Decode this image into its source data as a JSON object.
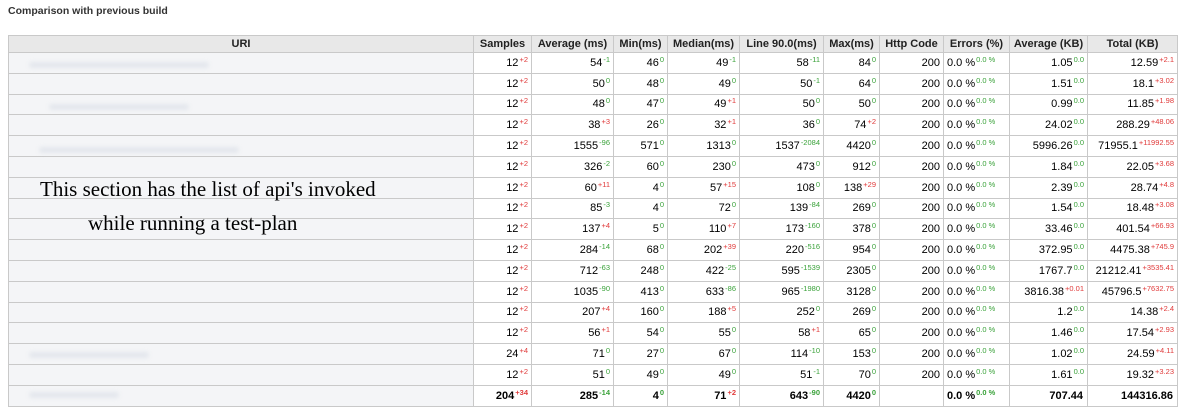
{
  "section_title": "Comparison with previous build",
  "annotation": {
    "line1": "This section has the list of api's invoked",
    "line2": "while running a test-plan"
  },
  "columns": [
    "URI",
    "Samples",
    "Average (ms)",
    "Min(ms)",
    "Median(ms)",
    "Line 90.0(ms)",
    "Max(ms)",
    "Http Code",
    "Errors (%)",
    "Average (KB)",
    "Total (KB)"
  ],
  "rows": [
    {
      "samples": [
        "12",
        "+2"
      ],
      "avg": [
        "54",
        "-1"
      ],
      "min": [
        "46",
        "0"
      ],
      "median": [
        "49",
        "-1"
      ],
      "line90": [
        "58",
        "-11"
      ],
      "max": [
        "84",
        "0"
      ],
      "code": "200",
      "err": [
        "0.0 %",
        "0.0 %"
      ],
      "avgkb": [
        "1.05",
        "0.0"
      ],
      "total": [
        "12.59",
        "+2.1"
      ]
    },
    {
      "samples": [
        "12",
        "+2"
      ],
      "avg": [
        "50",
        "0"
      ],
      "min": [
        "48",
        "0"
      ],
      "median": [
        "49",
        "0"
      ],
      "line90": [
        "50",
        "-1"
      ],
      "max": [
        "64",
        "0"
      ],
      "code": "200",
      "err": [
        "0.0 %",
        "0.0 %"
      ],
      "avgkb": [
        "1.51",
        "0.0"
      ],
      "total": [
        "18.1",
        "+3.02"
      ]
    },
    {
      "samples": [
        "12",
        "+2"
      ],
      "avg": [
        "48",
        "0"
      ],
      "min": [
        "47",
        "0"
      ],
      "median": [
        "49",
        "+1"
      ],
      "line90": [
        "50",
        "0"
      ],
      "max": [
        "50",
        "0"
      ],
      "code": "200",
      "err": [
        "0.0 %",
        "0.0 %"
      ],
      "avgkb": [
        "0.99",
        "0.0"
      ],
      "total": [
        "11.85",
        "+1.98"
      ]
    },
    {
      "samples": [
        "12",
        "+2"
      ],
      "avg": [
        "38",
        "+3"
      ],
      "min": [
        "26",
        "0"
      ],
      "median": [
        "32",
        "+1"
      ],
      "line90": [
        "36",
        "0"
      ],
      "max": [
        "74",
        "+2"
      ],
      "code": "200",
      "err": [
        "0.0 %",
        "0.0 %"
      ],
      "avgkb": [
        "24.02",
        "0.0"
      ],
      "total": [
        "288.29",
        "+48.06"
      ]
    },
    {
      "samples": [
        "12",
        "+2"
      ],
      "avg": [
        "1555",
        "-96"
      ],
      "min": [
        "571",
        "0"
      ],
      "median": [
        "1313",
        "0"
      ],
      "line90": [
        "1537",
        "-2084"
      ],
      "max": [
        "4420",
        "0"
      ],
      "code": "200",
      "err": [
        "0.0 %",
        "0.0 %"
      ],
      "avgkb": [
        "5996.26",
        "0.0"
      ],
      "total": [
        "71955.1",
        "+11992.55"
      ]
    },
    {
      "samples": [
        "12",
        "+2"
      ],
      "avg": [
        "326",
        "-2"
      ],
      "min": [
        "60",
        "0"
      ],
      "median": [
        "230",
        "0"
      ],
      "line90": [
        "473",
        "0"
      ],
      "max": [
        "912",
        "0"
      ],
      "code": "200",
      "err": [
        "0.0 %",
        "0.0 %"
      ],
      "avgkb": [
        "1.84",
        "0.0"
      ],
      "total": [
        "22.05",
        "+3.68"
      ]
    },
    {
      "samples": [
        "12",
        "+2"
      ],
      "avg": [
        "60",
        "+11"
      ],
      "min": [
        "4",
        "0"
      ],
      "median": [
        "57",
        "+15"
      ],
      "line90": [
        "108",
        "0"
      ],
      "max": [
        "138",
        "+29"
      ],
      "code": "200",
      "err": [
        "0.0 %",
        "0.0 %"
      ],
      "avgkb": [
        "2.39",
        "0.0"
      ],
      "total": [
        "28.74",
        "+4.8"
      ]
    },
    {
      "samples": [
        "12",
        "+2"
      ],
      "avg": [
        "85",
        "-3"
      ],
      "min": [
        "4",
        "0"
      ],
      "median": [
        "72",
        "0"
      ],
      "line90": [
        "139",
        "-84"
      ],
      "max": [
        "269",
        "0"
      ],
      "code": "200",
      "err": [
        "0.0 %",
        "0.0 %"
      ],
      "avgkb": [
        "1.54",
        "0.0"
      ],
      "total": [
        "18.48",
        "+3.08"
      ]
    },
    {
      "samples": [
        "12",
        "+2"
      ],
      "avg": [
        "137",
        "+4"
      ],
      "min": [
        "5",
        "0"
      ],
      "median": [
        "110",
        "+7"
      ],
      "line90": [
        "173",
        "-160"
      ],
      "max": [
        "378",
        "0"
      ],
      "code": "200",
      "err": [
        "0.0 %",
        "0.0 %"
      ],
      "avgkb": [
        "33.46",
        "0.0"
      ],
      "total": [
        "401.54",
        "+66.93"
      ]
    },
    {
      "samples": [
        "12",
        "+2"
      ],
      "avg": [
        "284",
        "-14"
      ],
      "min": [
        "68",
        "0"
      ],
      "median": [
        "202",
        "+39"
      ],
      "line90": [
        "220",
        "-516"
      ],
      "max": [
        "954",
        "0"
      ],
      "code": "200",
      "err": [
        "0.0 %",
        "0.0 %"
      ],
      "avgkb": [
        "372.95",
        "0.0"
      ],
      "total": [
        "4475.38",
        "+745.9"
      ]
    },
    {
      "samples": [
        "12",
        "+2"
      ],
      "avg": [
        "712",
        "-63"
      ],
      "min": [
        "248",
        "0"
      ],
      "median": [
        "422",
        "-25"
      ],
      "line90": [
        "595",
        "-1539"
      ],
      "max": [
        "2305",
        "0"
      ],
      "code": "200",
      "err": [
        "0.0 %",
        "0.0 %"
      ],
      "avgkb": [
        "1767.7",
        "0.0"
      ],
      "total": [
        "21212.41",
        "+3535.41"
      ]
    },
    {
      "samples": [
        "12",
        "+2"
      ],
      "avg": [
        "1035",
        "-90"
      ],
      "min": [
        "413",
        "0"
      ],
      "median": [
        "633",
        "-86"
      ],
      "line90": [
        "965",
        "-1980"
      ],
      "max": [
        "3128",
        "0"
      ],
      "code": "200",
      "err": [
        "0.0 %",
        "0.0 %"
      ],
      "avgkb": [
        "3816.38",
        "+0.01"
      ],
      "total": [
        "45796.5",
        "+7632.75"
      ]
    },
    {
      "samples": [
        "12",
        "+2"
      ],
      "avg": [
        "207",
        "+4"
      ],
      "min": [
        "160",
        "0"
      ],
      "median": [
        "188",
        "+5"
      ],
      "line90": [
        "252",
        "0"
      ],
      "max": [
        "269",
        "0"
      ],
      "code": "200",
      "err": [
        "0.0 %",
        "0.0 %"
      ],
      "avgkb": [
        "1.2",
        "0.0"
      ],
      "total": [
        "14.38",
        "+2.4"
      ]
    },
    {
      "samples": [
        "12",
        "+2"
      ],
      "avg": [
        "56",
        "+1"
      ],
      "min": [
        "54",
        "0"
      ],
      "median": [
        "55",
        "0"
      ],
      "line90": [
        "58",
        "+1"
      ],
      "max": [
        "65",
        "0"
      ],
      "code": "200",
      "err": [
        "0.0 %",
        "0.0 %"
      ],
      "avgkb": [
        "1.46",
        "0.0"
      ],
      "total": [
        "17.54",
        "+2.93"
      ]
    },
    {
      "samples": [
        "24",
        "+4"
      ],
      "avg": [
        "71",
        "0"
      ],
      "min": [
        "27",
        "0"
      ],
      "median": [
        "67",
        "0"
      ],
      "line90": [
        "114",
        "-10"
      ],
      "max": [
        "153",
        "0"
      ],
      "code": "200",
      "err": [
        "0.0 %",
        "0.0 %"
      ],
      "avgkb": [
        "1.02",
        "0.0"
      ],
      "total": [
        "24.59",
        "+4.11"
      ]
    },
    {
      "samples": [
        "12",
        "+2"
      ],
      "avg": [
        "51",
        "0"
      ],
      "min": [
        "49",
        "0"
      ],
      "median": [
        "49",
        "0"
      ],
      "line90": [
        "51",
        "-1"
      ],
      "max": [
        "70",
        "0"
      ],
      "code": "200",
      "err": [
        "0.0 %",
        "0.0 %"
      ],
      "avgkb": [
        "1.61",
        "0.0"
      ],
      "total": [
        "19.32",
        "+3.23"
      ]
    }
  ],
  "total_row": {
    "samples": [
      "204",
      "+34"
    ],
    "avg": [
      "285",
      "-14"
    ],
    "min": [
      "4",
      "0"
    ],
    "median": [
      "71",
      "+2"
    ],
    "line90": [
      "643",
      "-90"
    ],
    "max": [
      "4420",
      "0"
    ],
    "code": "",
    "err": [
      "0.0 %",
      "0.0 %"
    ],
    "avgkb": [
      "707.44",
      ""
    ],
    "total": [
      "144316.86",
      ""
    ]
  },
  "colors": {
    "increase": "#e03a3a",
    "decrease": "#3aa23a",
    "header_bg": "#e8e8e8",
    "border": "#c9c9c9"
  }
}
